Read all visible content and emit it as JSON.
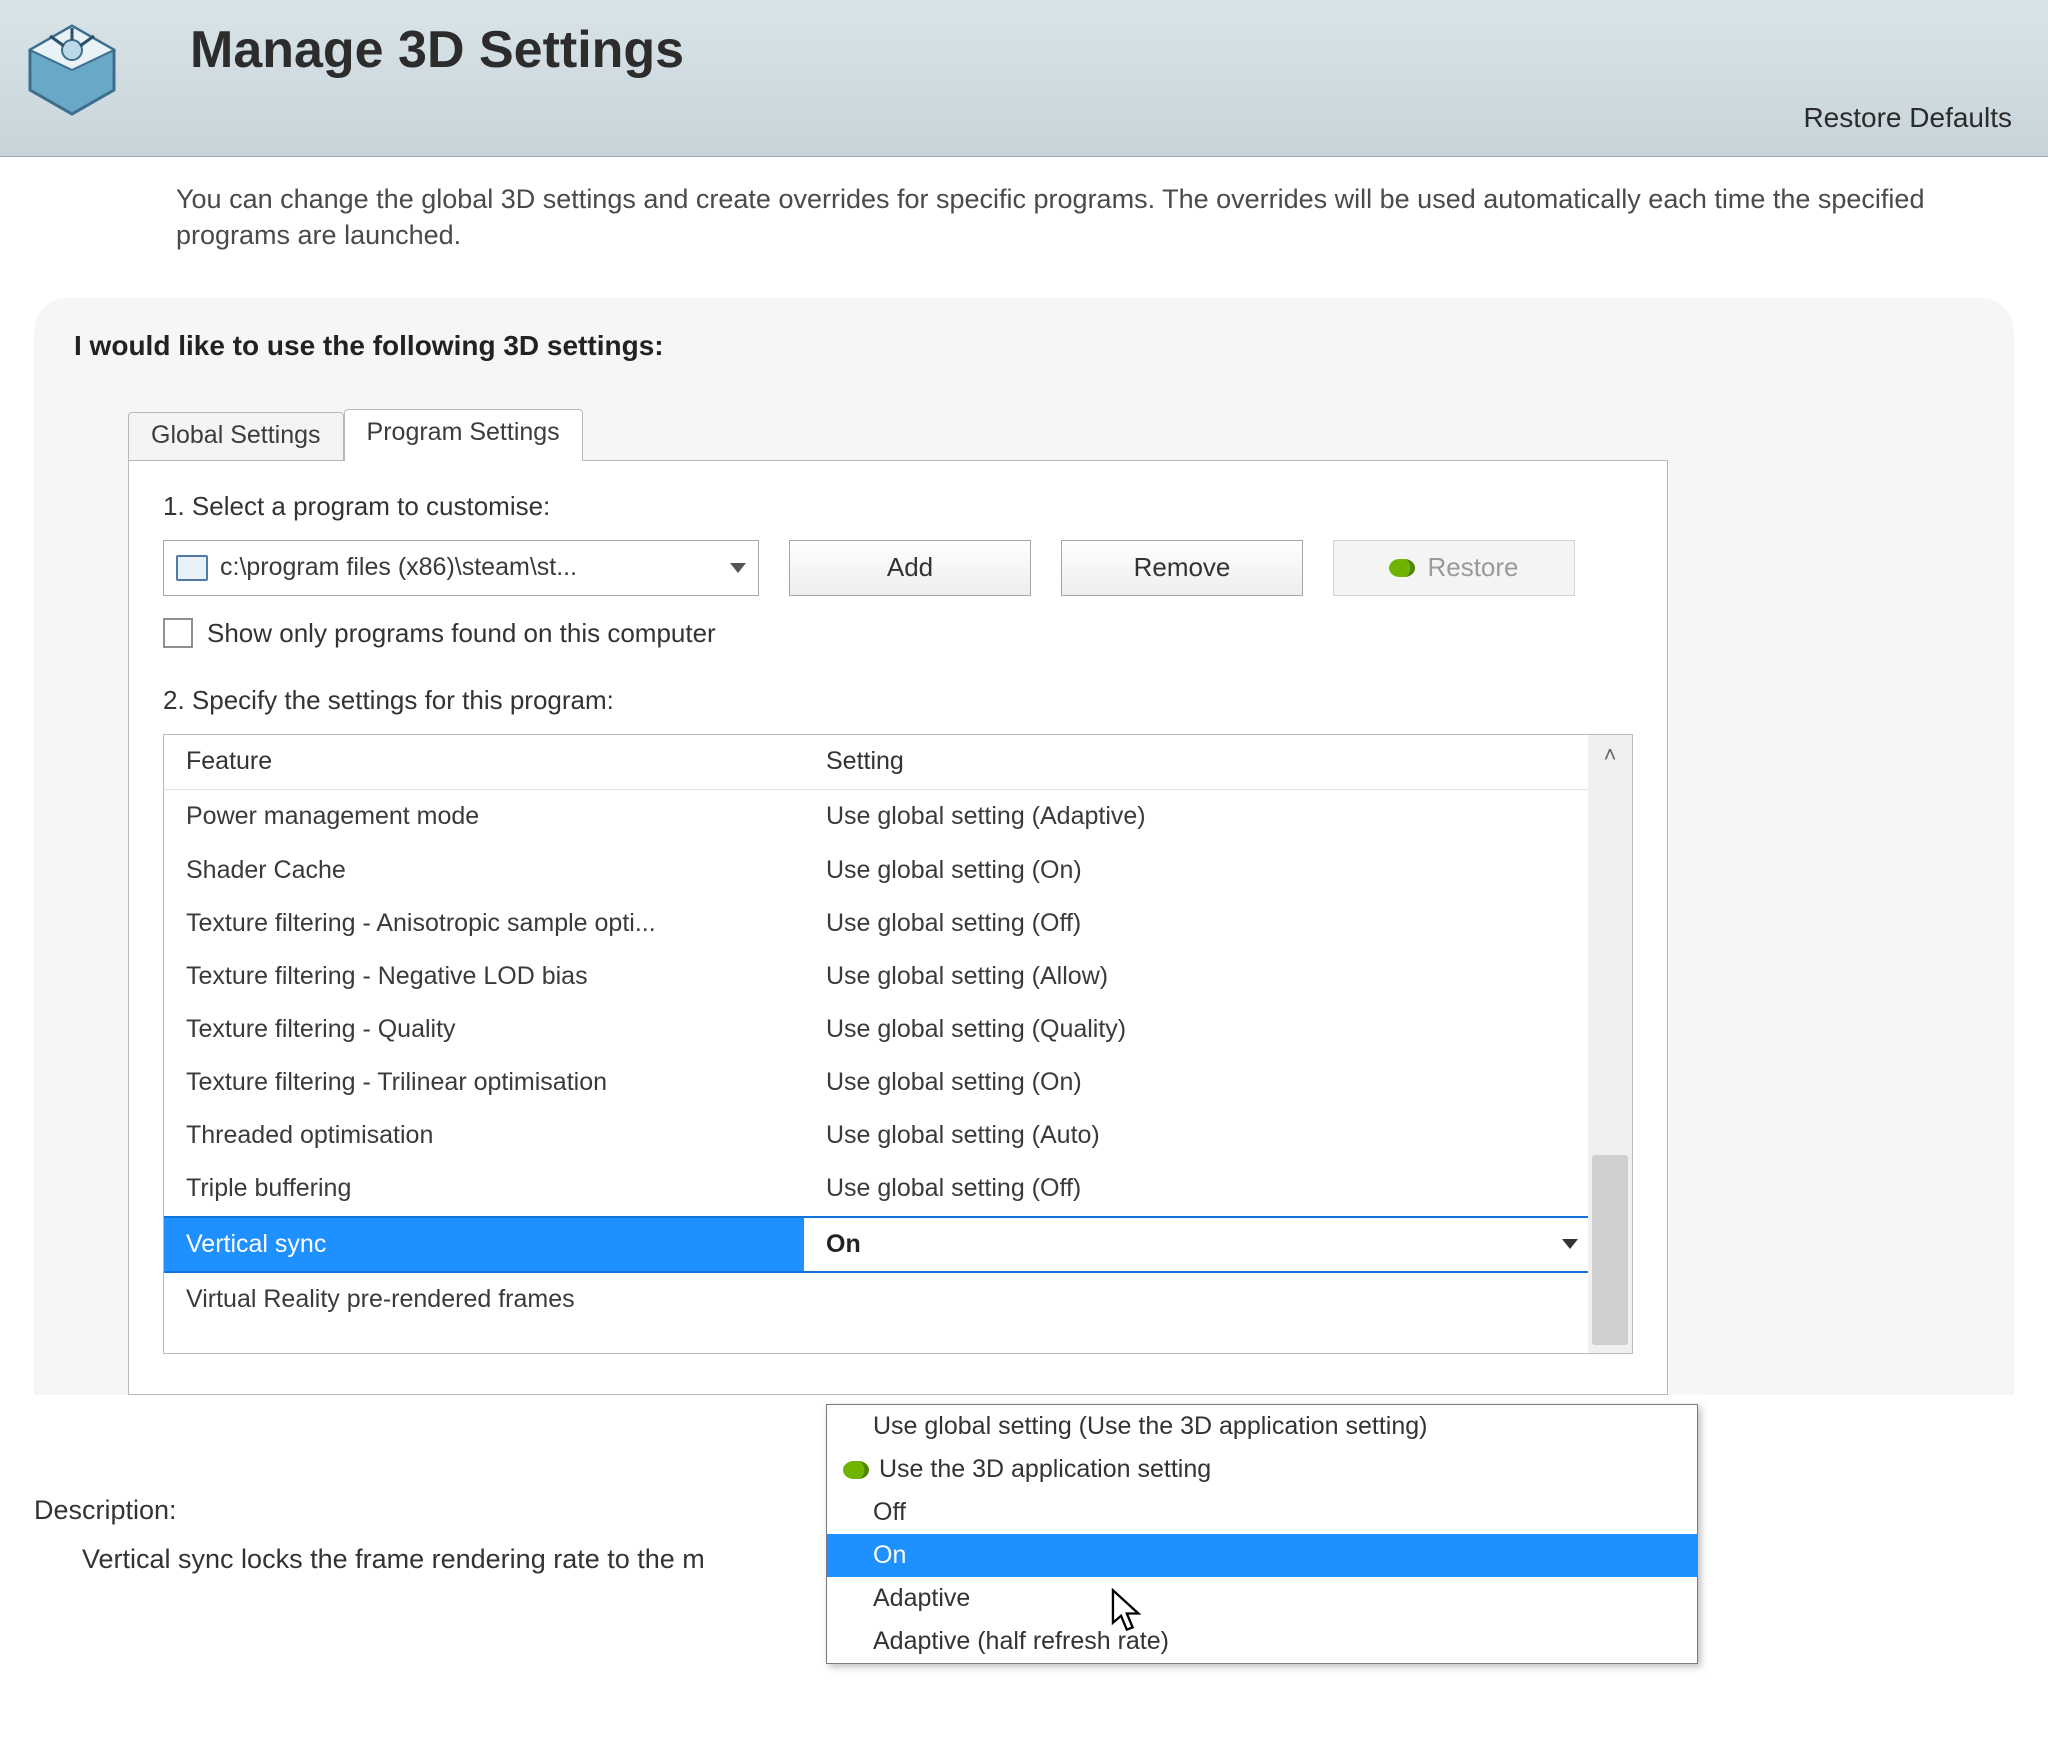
{
  "header": {
    "title": "Manage 3D Settings",
    "restore_defaults": "Restore Defaults"
  },
  "intro": "You can change the global 3D settings and create overrides for specific programs. The overrides will be used automatically each time the specified programs are launched.",
  "section_heading": "I would like to use the following 3D settings:",
  "tabs": {
    "global": "Global Settings",
    "program": "Program Settings"
  },
  "program_select": {
    "step1_label": "1. Select a program to customise:",
    "selected": "c:\\program files (x86)\\steam\\st...",
    "add": "Add",
    "remove": "Remove",
    "restore": "Restore",
    "checkbox_label": "Show only programs found on this computer",
    "step2_label": "2. Specify the settings for this program:"
  },
  "table": {
    "col_feature": "Feature",
    "col_setting": "Setting",
    "rows": [
      {
        "feature": "Power management mode",
        "setting": "Use global setting (Adaptive)"
      },
      {
        "feature": "Shader Cache",
        "setting": "Use global setting (On)"
      },
      {
        "feature": "Texture filtering - Anisotropic sample opti...",
        "setting": "Use global setting (Off)"
      },
      {
        "feature": "Texture filtering - Negative LOD bias",
        "setting": "Use global setting (Allow)"
      },
      {
        "feature": "Texture filtering - Quality",
        "setting": "Use global setting (Quality)"
      },
      {
        "feature": "Texture filtering - Trilinear optimisation",
        "setting": "Use global setting (On)"
      },
      {
        "feature": "Threaded optimisation",
        "setting": "Use global setting (Auto)"
      },
      {
        "feature": "Triple buffering",
        "setting": "Use global setting (Off)"
      },
      {
        "feature": "Vertical sync",
        "setting": "On",
        "selected": true
      },
      {
        "feature": "Virtual Reality pre-rendered frames",
        "setting": ""
      }
    ]
  },
  "dropdown": {
    "options": [
      {
        "label": "Use global setting (Use the 3D application setting)"
      },
      {
        "label": "Use the 3D application setting",
        "nvidia": true
      },
      {
        "label": "Off"
      },
      {
        "label": "On",
        "hovered": true
      },
      {
        "label": "Adaptive"
      },
      {
        "label": "Adaptive (half refresh rate)"
      }
    ]
  },
  "description": {
    "label": "Description:",
    "text": "Vertical sync locks the frame rendering rate to the m"
  }
}
